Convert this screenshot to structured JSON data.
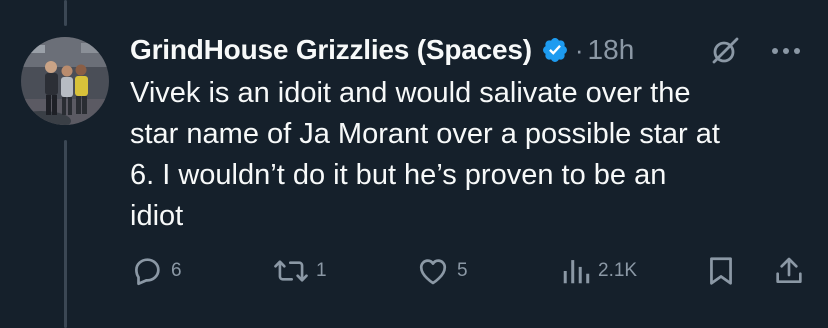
{
  "tweet": {
    "author_name": "GrindHouse Grizzlies (Spaces)",
    "timestamp_separator": "·",
    "timestamp": "18h",
    "text": "Vivek is an idoit and would salivate over the\nstar name of Ja Morant over a possible star at\n6. I wouldn’t do it but he’s proven to be an\nidiot",
    "verified_color": "#1d9bf0"
  },
  "actions": {
    "reply_count": "6",
    "retweet_count": "1",
    "like_count": "5",
    "views_count": "2.1K"
  },
  "icons": {
    "verified": "verified-badge-icon",
    "grok": "grok-icon",
    "more": "more-dots-icon",
    "reply": "reply-icon",
    "retweet": "retweet-icon",
    "like": "heart-icon",
    "views": "views-chart-icon",
    "bookmark": "bookmark-icon",
    "share": "share-icon"
  },
  "colors": {
    "background": "#15202b",
    "text": "#f7f9f9",
    "muted": "#8b98a5",
    "thread_line": "#3b4754"
  }
}
